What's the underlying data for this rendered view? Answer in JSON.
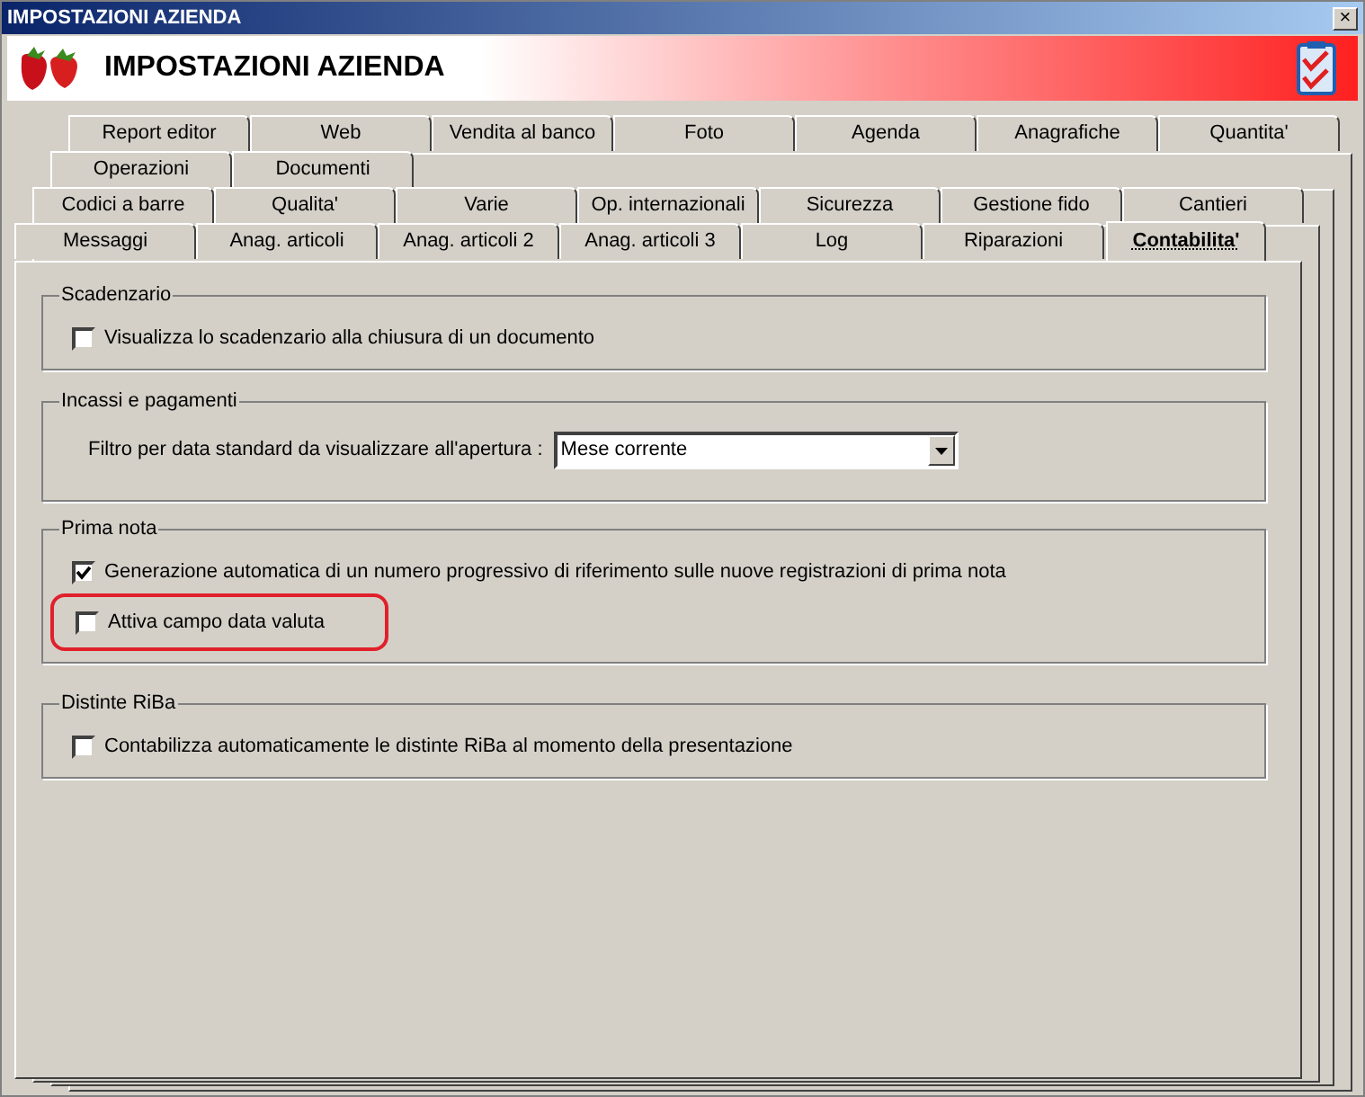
{
  "window": {
    "title": "IMPOSTAZIONI AZIENDA",
    "close": "×"
  },
  "header": {
    "title": "IMPOSTAZIONI AZIENDA"
  },
  "tab_rows": [
    [
      {
        "label": "Report editor",
        "selected": false
      },
      {
        "label": "Web",
        "selected": false
      },
      {
        "label": "Vendita al banco",
        "selected": false
      },
      {
        "label": "Foto",
        "selected": false
      },
      {
        "label": "Agenda",
        "selected": false
      },
      {
        "label": "Anagrafiche",
        "selected": false
      },
      {
        "label": "Quantita'",
        "selected": false
      }
    ],
    [
      {
        "label": "Operazioni",
        "selected": false
      },
      {
        "label": "Documenti",
        "selected": false
      }
    ],
    [
      {
        "label": "Codici a barre",
        "selected": false
      },
      {
        "label": "Qualita'",
        "selected": false
      },
      {
        "label": "Varie",
        "selected": false
      },
      {
        "label": "Op. internazionali",
        "selected": false
      },
      {
        "label": "Sicurezza",
        "selected": false
      },
      {
        "label": "Gestione fido",
        "selected": false
      },
      {
        "label": "Cantieri",
        "selected": false
      }
    ],
    [
      {
        "label": "Messaggi",
        "selected": false
      },
      {
        "label": "Anag. articoli",
        "selected": false
      },
      {
        "label": "Anag. articoli 2",
        "selected": false
      },
      {
        "label": "Anag. articoli 3",
        "selected": false
      },
      {
        "label": "Log",
        "selected": false
      },
      {
        "label": "Riparazioni",
        "selected": false
      },
      {
        "label": "Contabilita'",
        "selected": true
      }
    ]
  ],
  "groups": [
    {
      "title": "Scadenzario",
      "items": [
        {
          "kind": "checkbox",
          "label": "Visualizza lo scadenzario alla chiusura di un documento",
          "checked": false,
          "highlighted": false
        }
      ]
    },
    {
      "title": "Incassi e pagamenti",
      "items": [
        {
          "kind": "dropdown",
          "label": "Filtro per data standard da visualizzare all'apertura :",
          "value": "Mese corrente"
        }
      ]
    },
    {
      "title": "Prima nota",
      "items": [
        {
          "kind": "checkbox",
          "label": "Generazione automatica di un numero progressivo di riferimento sulle nuove registrazioni di prima nota",
          "checked": true,
          "highlighted": false
        },
        {
          "kind": "checkbox",
          "label": "Attiva campo data valuta",
          "checked": false,
          "highlighted": true
        }
      ]
    },
    {
      "title": "Distinte RiBa",
      "items": [
        {
          "kind": "checkbox",
          "label": "Contabilizza automaticamente le distinte RiBa al momento della presentazione",
          "checked": false,
          "highlighted": false
        }
      ]
    }
  ]
}
